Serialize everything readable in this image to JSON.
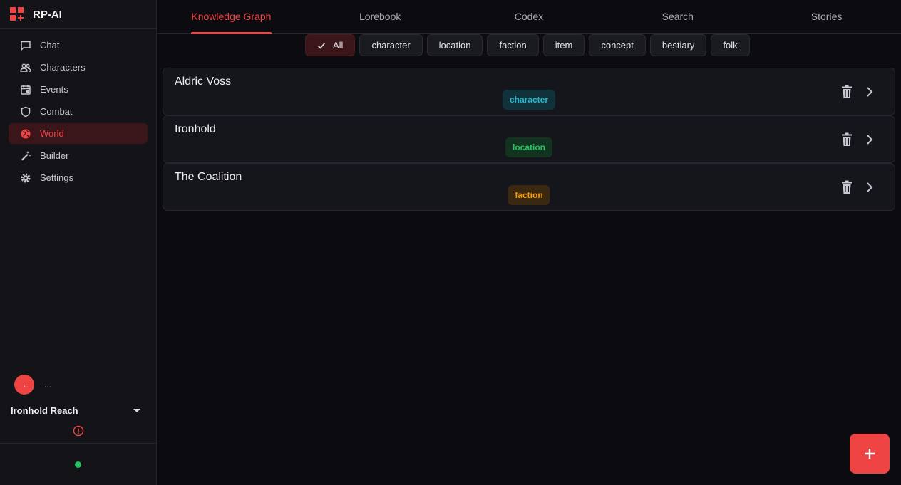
{
  "app": {
    "name": "RP-AI"
  },
  "sidebar": {
    "items": [
      {
        "label": "Chat",
        "icon": "chat-icon",
        "active": false
      },
      {
        "label": "Characters",
        "icon": "users-icon",
        "active": false
      },
      {
        "label": "Events",
        "icon": "calendar-icon",
        "active": false
      },
      {
        "label": "Combat",
        "icon": "shield-icon",
        "active": false
      },
      {
        "label": "World",
        "icon": "globe-icon",
        "active": true
      },
      {
        "label": "Builder",
        "icon": "wand-icon",
        "active": false
      },
      {
        "label": "Settings",
        "icon": "gear-icon",
        "active": false
      }
    ],
    "user": {
      "avatar_text": ".",
      "name": "..."
    },
    "world_select": {
      "value": "Ironhold Reach"
    }
  },
  "tabs": [
    {
      "label": "Knowledge Graph",
      "active": true
    },
    {
      "label": "Lorebook",
      "active": false
    },
    {
      "label": "Codex",
      "active": false
    },
    {
      "label": "Search",
      "active": false
    },
    {
      "label": "Stories",
      "active": false
    }
  ],
  "filters": [
    {
      "label": "All",
      "active": true
    },
    {
      "label": "character",
      "active": false
    },
    {
      "label": "location",
      "active": false
    },
    {
      "label": "faction",
      "active": false
    },
    {
      "label": "item",
      "active": false
    },
    {
      "label": "concept",
      "active": false
    },
    {
      "label": "bestiary",
      "active": false
    },
    {
      "label": "folk",
      "active": false
    }
  ],
  "entries": [
    {
      "title": "Aldric Voss",
      "type": "character"
    },
    {
      "title": "Ironhold",
      "type": "location"
    },
    {
      "title": "The Coalition",
      "type": "faction"
    }
  ],
  "colors": {
    "accent": "#ef4444",
    "character": "#22b8cf",
    "location": "#22c55e",
    "faction": "#f59e0b",
    "status_online": "#22c55e"
  }
}
